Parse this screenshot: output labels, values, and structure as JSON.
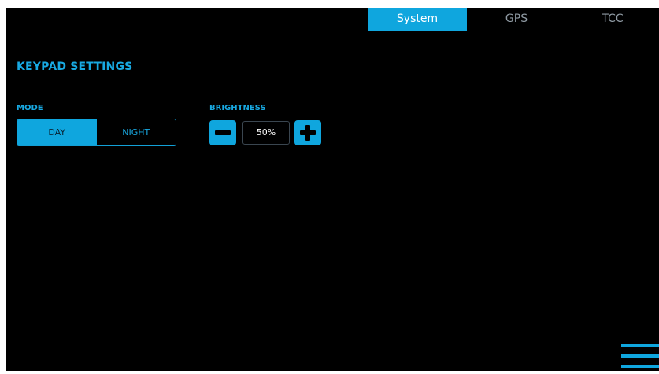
{
  "tabs": [
    {
      "label": "System",
      "active": true
    },
    {
      "label": "GPS",
      "active": false
    },
    {
      "label": "TCC",
      "active": false
    }
  ],
  "section": {
    "title": "KEYPAD SETTINGS"
  },
  "mode": {
    "label": "MODE",
    "options": [
      "DAY",
      "NIGHT"
    ],
    "selected": "DAY"
  },
  "brightness": {
    "label": "BRIGHTNESS",
    "value": "50%"
  },
  "icons": {
    "decrease": "minus-icon",
    "increase": "plus-icon",
    "menu": "hamburger-menu-icon"
  },
  "colors": {
    "accent": "#0fa6de",
    "background": "#000000",
    "inactive_tab_text": "#8f9aa3"
  }
}
